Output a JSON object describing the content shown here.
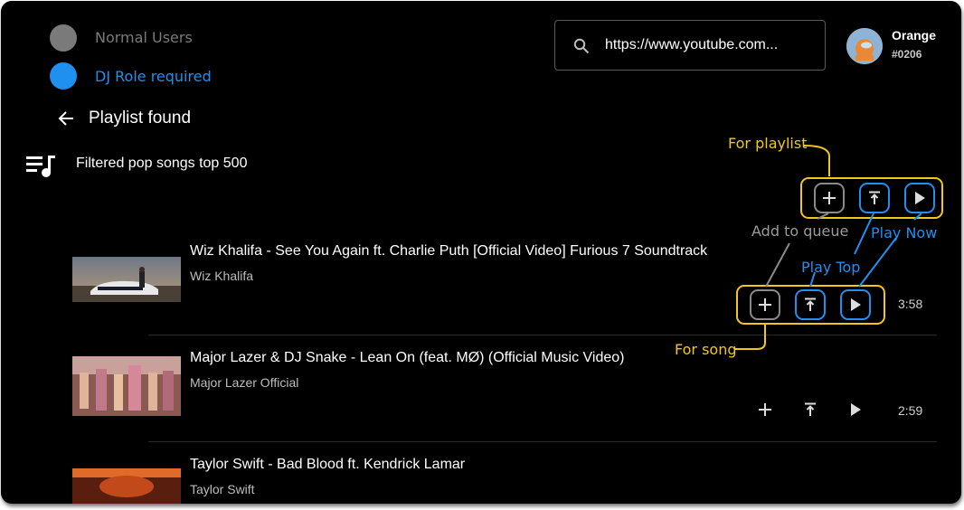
{
  "legend": {
    "normal_label": "Normal Users",
    "dj_label": "DJ Role required",
    "normal_color": "#7a7a7a",
    "dj_color": "#1f8ff0"
  },
  "search": {
    "icon": "search-icon",
    "value": "https://www.youtube.com..."
  },
  "user": {
    "name": "Orange",
    "tag": "#0206",
    "avatar_icon": "avatar-icon"
  },
  "header": {
    "back_icon": "arrow-left-icon",
    "title": "Playlist found"
  },
  "playlist": {
    "icon": "playlist-music-icon",
    "name": "Filtered pop songs top 500"
  },
  "songs": [
    {
      "title": "Wiz Khalifa - See You Again ft. Charlie Puth [Official Video] Furious 7 Soundtrack",
      "artist": "Wiz Khalifa",
      "duration": "3:58"
    },
    {
      "title": "Major Lazer & DJ Snake - Lean On (feat. MØ) (Official Music Video)",
      "artist": "Major Lazer Official",
      "duration": "2:59"
    },
    {
      "title": "Taylor Swift - Bad Blood ft. Kendrick Lamar",
      "artist": "Taylor Swift",
      "duration": ""
    }
  ],
  "annotations": {
    "for_playlist": "For playlist",
    "for_song": "For song",
    "add_to_queue": "Add to queue",
    "play_top": "Play Top",
    "play_now": "Play Now",
    "yellow": "#f2c71c",
    "blue": "#1f8ff0",
    "gray": "#9a9a9a"
  },
  "icons": {
    "add": "plus-icon",
    "play_top": "play-top-icon",
    "play_now": "play-icon"
  }
}
